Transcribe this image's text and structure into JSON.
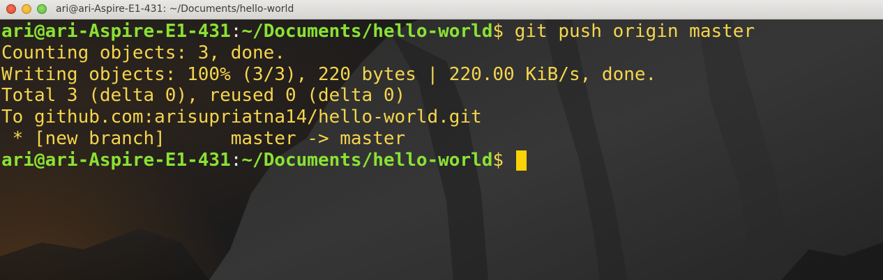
{
  "window": {
    "title": "ari@ari-Aspire-E1-431: ~/Documents/hello-world"
  },
  "terminal": {
    "prompt": {
      "user_host": "ari@ari-Aspire-E1-431",
      "separator": ":",
      "path": "~/Documents/hello-world",
      "symbol": "$"
    },
    "command": " git push origin master",
    "output": [
      "Counting objects: 3, done.",
      "Writing objects: 100% (3/3), 220 bytes | 220.00 KiB/s, done.",
      "Total 3 (delta 0), reused 0 (delta 0)",
      "To github.com:arisupriatna14/hello-world.git",
      " * [new branch]      master -> master"
    ],
    "colors": {
      "prompt_green": "#8ae234",
      "text_yellow": "#f4d54e",
      "cursor": "#f9d207"
    }
  }
}
